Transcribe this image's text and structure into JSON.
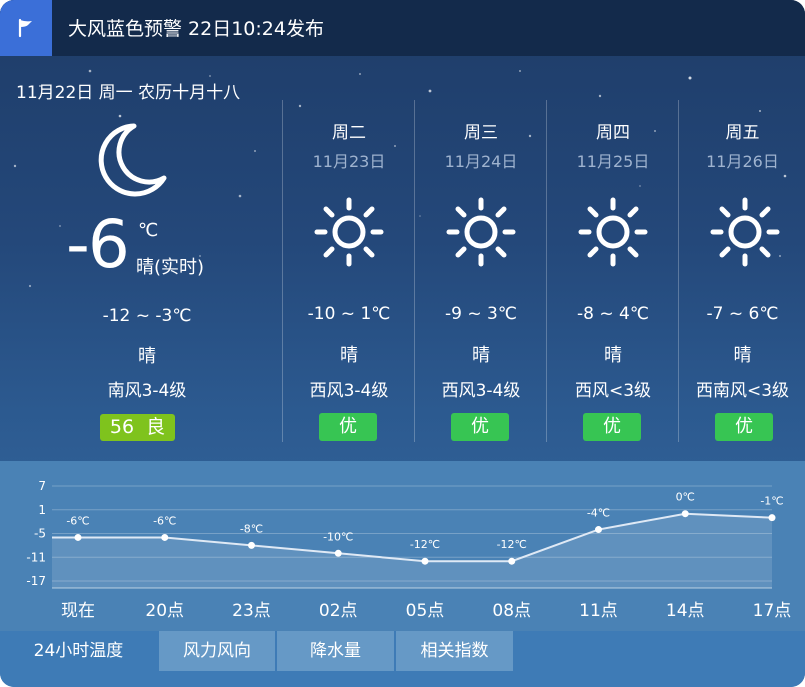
{
  "alert": {
    "icon": "flag-icon",
    "text": "大风蓝色预警 22日10:24发布"
  },
  "date_line": "11月22日 周一 农历十月十八",
  "today": {
    "icon": "moon-icon",
    "temp": "-6",
    "unit": "℃",
    "condition": "晴(实时)",
    "range": "-12 ~ -3℃",
    "weather": "晴",
    "wind": "南风3-4级",
    "aqi": "56  良",
    "aqi_color": "#7fc31d"
  },
  "forecast": [
    {
      "day": "周二",
      "date": "11月23日",
      "icon": "sun-icon",
      "range": "-10 ~ 1℃",
      "weather": "晴",
      "wind": "西风3-4级",
      "aq": "优"
    },
    {
      "day": "周三",
      "date": "11月24日",
      "icon": "sun-icon",
      "range": "-9 ~ 3℃",
      "weather": "晴",
      "wind": "西风3-4级",
      "aq": "优"
    },
    {
      "day": "周四",
      "date": "11月25日",
      "icon": "sun-icon",
      "range": "-8 ~ 4℃",
      "weather": "晴",
      "wind": "西风<3级",
      "aq": "优"
    },
    {
      "day": "周五",
      "date": "11月26日",
      "icon": "sun-icon",
      "range": "-7 ~ 6℃",
      "weather": "晴",
      "wind": "西南风<3级",
      "aq": "优"
    }
  ],
  "good_color": "#37c553",
  "chart_data": {
    "type": "area",
    "categories": [
      "现在",
      "20点",
      "23点",
      "02点",
      "05点",
      "08点",
      "11点",
      "14点",
      "17点"
    ],
    "values": [
      -6,
      -6,
      -8,
      -10,
      -12,
      -12,
      -4,
      0,
      -1
    ],
    "labels": [
      "-6℃",
      "-6℃",
      "-8℃",
      "-10℃",
      "-12℃",
      "-12℃",
      "-4℃",
      "0℃",
      "-1℃"
    ],
    "yticks": [
      "7",
      "1",
      "-5",
      "-11",
      "-17"
    ],
    "ylim": [
      -17,
      7
    ],
    "grid": true
  },
  "tabs": [
    {
      "label": "24小时温度",
      "active": true
    },
    {
      "label": "风力风向",
      "active": false
    },
    {
      "label": "降水量",
      "active": false
    },
    {
      "label": "相关指数",
      "active": false
    }
  ]
}
